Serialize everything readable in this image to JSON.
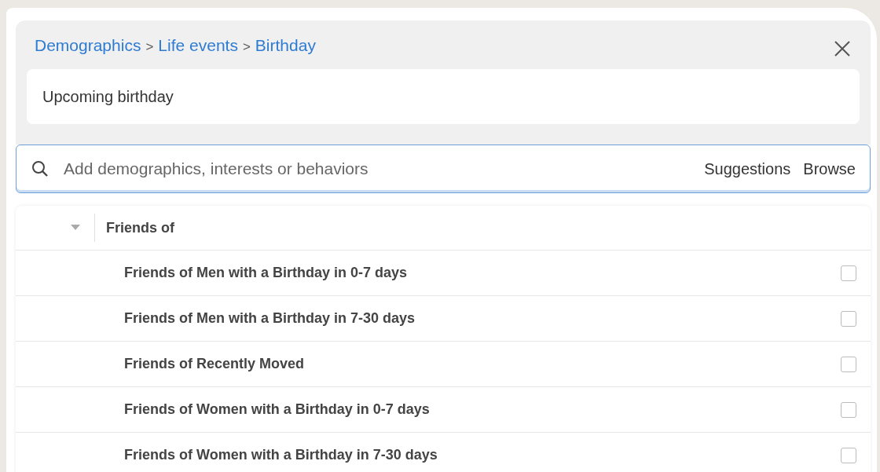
{
  "breadcrumb": [
    {
      "kind": "link",
      "text": "Demographics"
    },
    {
      "kind": "separator",
      "text": ">"
    },
    {
      "kind": "link",
      "text": "Life events"
    },
    {
      "kind": "separator",
      "text": ">"
    },
    {
      "kind": "link",
      "text": "Birthday"
    }
  ],
  "selection": {
    "value": "Upcoming birthday"
  },
  "search": {
    "placeholder": "Add demographics, interests or behaviors",
    "actions": [
      "Suggestions",
      "Browse"
    ]
  },
  "tree": [
    {
      "label": "Friends of",
      "expanded": true,
      "children": [
        {
          "label": "Friends of Men with a Birthday in 0-7 days",
          "checked": false
        },
        {
          "label": "Friends of Men with a Birthday in 7-30 days",
          "checked": false
        },
        {
          "label": "Friends of Recently Moved",
          "checked": false
        },
        {
          "label": "Friends of Women with a Birthday in 0-7 days",
          "checked": false
        },
        {
          "label": "Friends of Women with a Birthday in 7-30 days",
          "checked": false
        }
      ]
    }
  ]
}
